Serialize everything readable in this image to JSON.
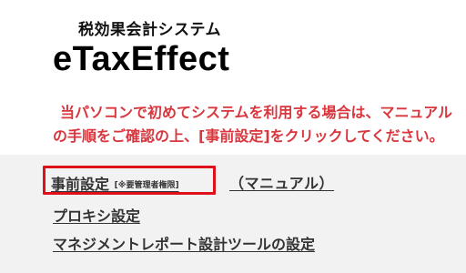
{
  "header": {
    "subtitle": "税効果会計システム",
    "logo": "eTaxEffect"
  },
  "notice": {
    "line1": "当パソコンで初めてシステムを利用する場合は、マニュアル",
    "line2": "の手順をご確認の上、[事前設定]をクリックしてください。",
    "color": "#d9363e"
  },
  "menu": {
    "prior_settings_label": "事前設定",
    "prior_settings_note": "[※要管理者権限]",
    "manual_link": "（マニュアル）",
    "proxy_settings_label": "プロキシ設定",
    "report_tool_settings_label": "マネジメントレポート設計ツールの設定",
    "highlight_color": "#e0101a"
  }
}
